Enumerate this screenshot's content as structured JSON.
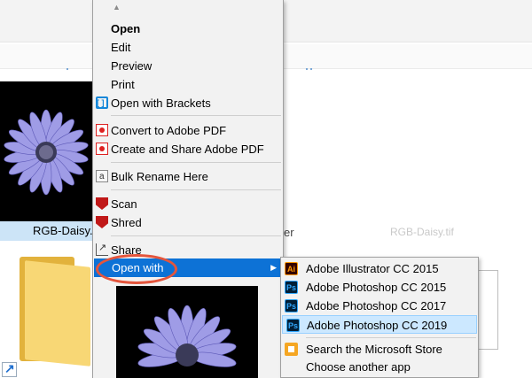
{
  "explorer": {
    "left_file_caption": "RGB-Daisy.p",
    "partial_caption_right": "er",
    "ghost_caption": "RGB-Daisy.tif"
  },
  "context_menu": {
    "items": [
      {
        "label": "Open",
        "bold": true,
        "icon": null
      },
      {
        "label": "Edit",
        "icon": null
      },
      {
        "label": "Preview",
        "icon": null
      },
      {
        "label": "Print",
        "icon": null
      },
      {
        "label": "Open with Brackets",
        "icon": "brackets-icon"
      },
      {
        "label": "Convert to Adobe PDF",
        "icon": "adobe-pdf-icon"
      },
      {
        "label": "Create and Share Adobe PDF",
        "icon": "adobe-pdf-icon"
      },
      {
        "label": "Bulk Rename Here",
        "icon": "rename-icon"
      },
      {
        "label": "Scan",
        "icon": "mcafee-icon"
      },
      {
        "label": "Shred",
        "icon": "mcafee-icon"
      },
      {
        "label": "Share",
        "icon": "share-icon"
      },
      {
        "label": "Open with",
        "icon": null,
        "submenu": true
      }
    ]
  },
  "submenu": {
    "items": [
      {
        "label": "Adobe Illustrator CC 2015",
        "icon": "illustrator-icon",
        "badge": "Ai"
      },
      {
        "label": "Adobe Photoshop CC 2015",
        "icon": "photoshop-icon",
        "badge": "Ps"
      },
      {
        "label": "Adobe Photoshop CC 2017",
        "icon": "photoshop-icon",
        "badge": "Ps"
      },
      {
        "label": "Adobe Photoshop CC 2019",
        "icon": "photoshop-icon",
        "badge": "Ps",
        "selected": true
      },
      {
        "label": "Search the Microsoft Store",
        "icon": "store-icon"
      },
      {
        "label": "Choose another app",
        "icon": null
      }
    ]
  },
  "colors": {
    "menu_bg": "#f2f2f2",
    "highlight": "#0d72d6",
    "submenu_selected": "#cce8ff",
    "annotation": "#e4553c",
    "daisy_petal": "#9f9ce6"
  }
}
